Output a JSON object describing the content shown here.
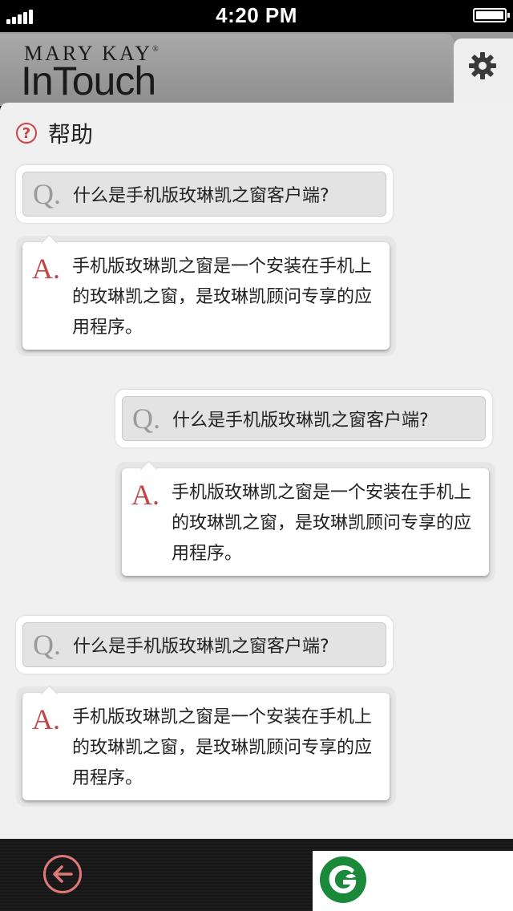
{
  "status_bar": {
    "time": "4:20 PM",
    "signal_icon": "signal-bars-icon",
    "battery_icon": "battery-full-icon"
  },
  "header": {
    "brand_top": "MARY KAY",
    "brand_reg": "®",
    "brand_main": "InTouch",
    "settings_icon": "gear-icon"
  },
  "page": {
    "title": "帮助",
    "title_icon": "question-circle-icon"
  },
  "faq": [
    {
      "q_letter": "Q.",
      "question": "什么是手机版玫琳凯之窗客户端?",
      "a_letter": "A.",
      "answer": "手机版玫琳凯之窗是一个安装在手机上的玫琳凯之窗，是玫琳凯顾问专享的应用程序。"
    },
    {
      "q_letter": "Q.",
      "question": "什么是手机版玫琳凯之窗客户端?",
      "a_letter": "A.",
      "answer": "手机版玫琳凯之窗是一个安装在手机上的玫琳凯之窗，是玫琳凯顾问专享的应用程序。"
    },
    {
      "q_letter": "Q.",
      "question": "什么是手机版玫琳凯之窗客户端?",
      "a_letter": "A.",
      "answer": "手机版玫琳凯之窗是一个安装在手机上的玫琳凯之窗，是玫琳凯顾问专享的应用程序。"
    }
  ],
  "bottom_bar": {
    "back_icon": "back-arrow-icon",
    "logo_icon": "green-g-logo-icon"
  },
  "colors": {
    "accent_red": "#c24444",
    "logo_green": "#1a8a3a"
  }
}
